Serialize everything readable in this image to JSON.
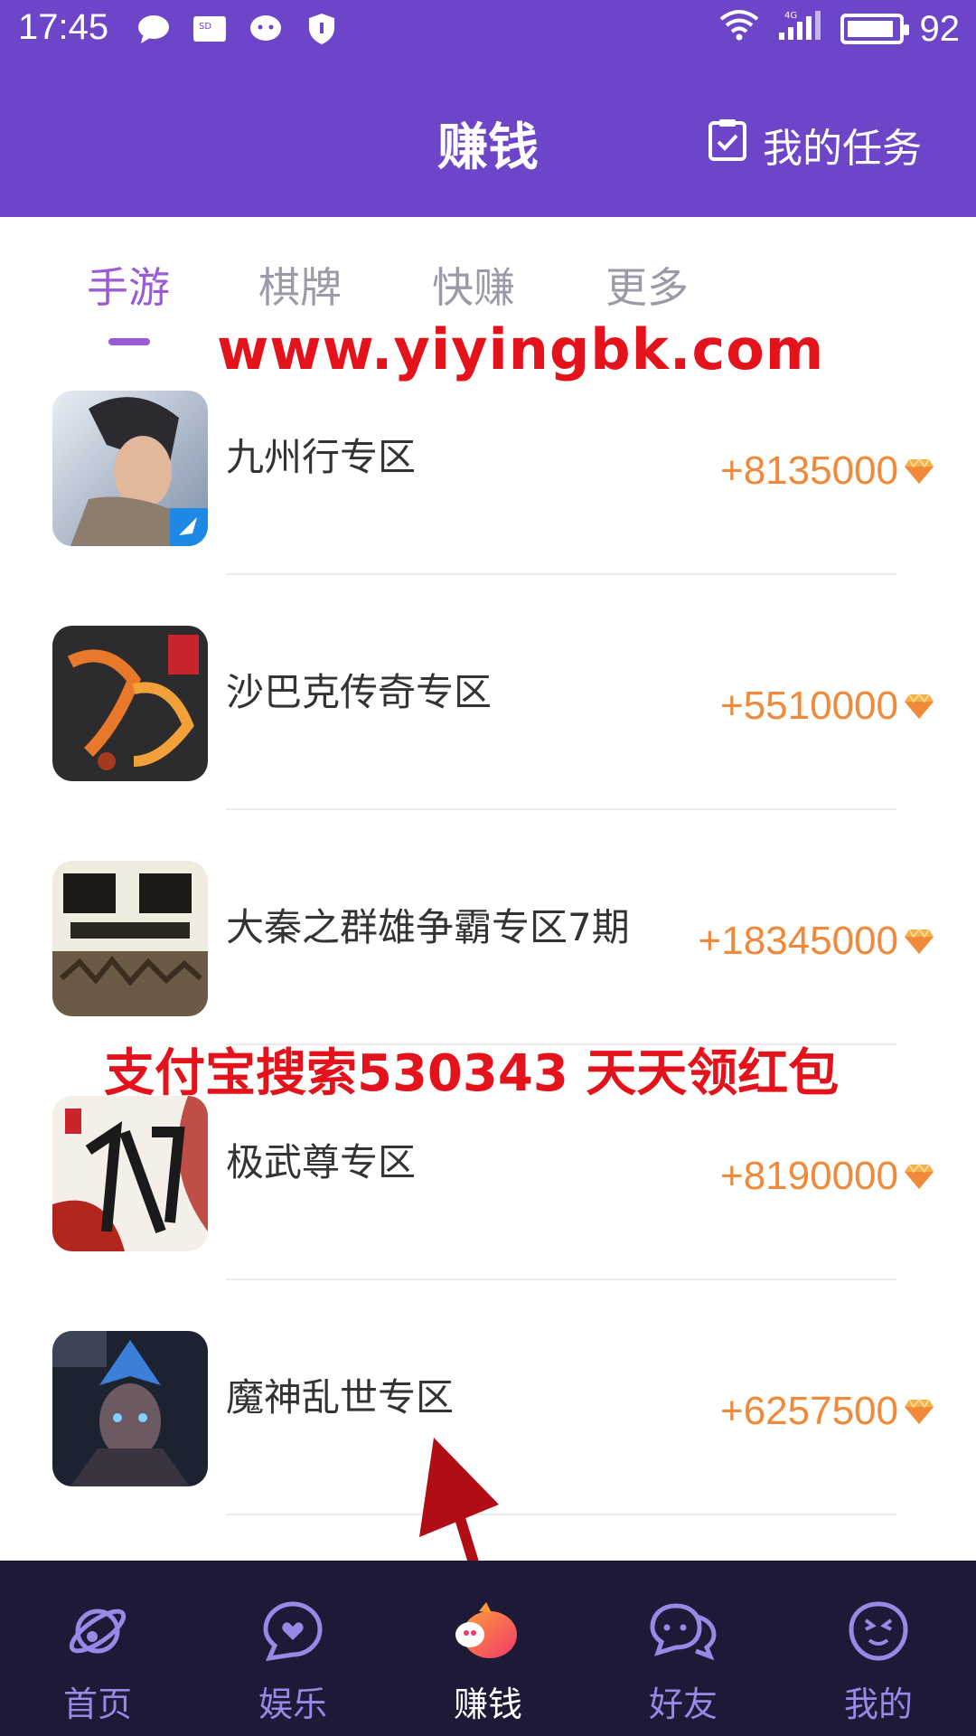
{
  "status_bar": {
    "time": "17:45",
    "battery": "92"
  },
  "header": {
    "title": "赚钱",
    "my_tasks": "我的任务"
  },
  "tabs": [
    "手游",
    "棋牌",
    "快赚",
    "更多"
  ],
  "active_tab": 0,
  "watermark_url": "www.yiyingbk.com",
  "watermark_promo": "支付宝搜索530343 天天领红包",
  "games": [
    {
      "title": "九州行专区",
      "reward": "+8135000"
    },
    {
      "title": "沙巴克传奇专区",
      "reward": "+5510000"
    },
    {
      "title": "大秦之群雄争霸专区7期",
      "reward": "+18345000"
    },
    {
      "title": "极武尊专区",
      "reward": "+8190000"
    },
    {
      "title": "魔神乱世专区",
      "reward": "+6257500"
    }
  ],
  "bottom_nav": [
    {
      "label": "首页",
      "icon": "planet-icon"
    },
    {
      "label": "娱乐",
      "icon": "chat-heart-icon"
    },
    {
      "label": "赚钱",
      "icon": "piggy-bank-icon"
    },
    {
      "label": "好友",
      "icon": "friends-chat-icon"
    },
    {
      "label": "我的",
      "icon": "smiley-face-icon"
    }
  ],
  "active_nav": 2,
  "colors": {
    "header_bg": "#6c45c9",
    "accent": "#9b5bd6",
    "reward": "#f08a3a",
    "nav_bg": "#1c1a36",
    "watermark": "#e4121b"
  }
}
